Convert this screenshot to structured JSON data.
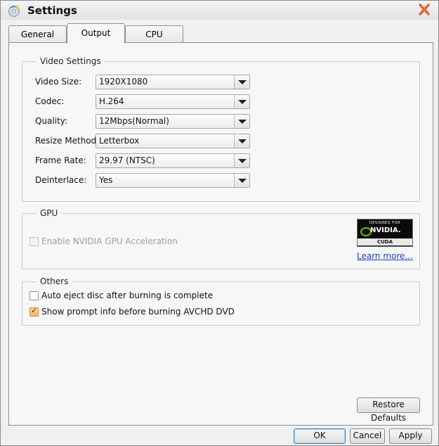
{
  "window": {
    "title": "Settings",
    "icons": {
      "app": "app-disc-icon",
      "close": "close-icon"
    },
    "accent_close_color": "#e05a28"
  },
  "tabs": [
    {
      "label": "General",
      "active": false
    },
    {
      "label": "Output",
      "active": true
    },
    {
      "label": "CPU",
      "active": false
    }
  ],
  "video_settings": {
    "legend": "Video Settings",
    "rows": [
      {
        "label": "Video Size:",
        "value": "1920X1080"
      },
      {
        "label": "Codec:",
        "value": "H.264"
      },
      {
        "label": "Quality:",
        "value": "12Mbps(Normal)"
      },
      {
        "label": "Resize Method:",
        "value": "Letterbox"
      },
      {
        "label": "Frame Rate:",
        "value": "29.97 (NTSC)"
      },
      {
        "label": "Deinterlace:",
        "value": "Yes"
      }
    ]
  },
  "gpu": {
    "legend": "GPU",
    "enable_label": "Enable NVIDIA GPU Acceleration",
    "enable_checked": false,
    "enable_disabled": true,
    "badge": {
      "top": "DESIGNED FOR",
      "brand": "NVIDIA.",
      "bottom": "CUDA"
    },
    "learn_more": "Learn more..."
  },
  "others": {
    "legend": "Others",
    "options": [
      {
        "label": "Auto eject disc after burning is complete",
        "checked": false
      },
      {
        "label": "Show prompt info before burning AVCHD DVD",
        "checked": true
      }
    ]
  },
  "buttons": {
    "restore_defaults": "Restore Defaults",
    "ok": "OK",
    "cancel": "Cancel",
    "apply": "Apply"
  }
}
